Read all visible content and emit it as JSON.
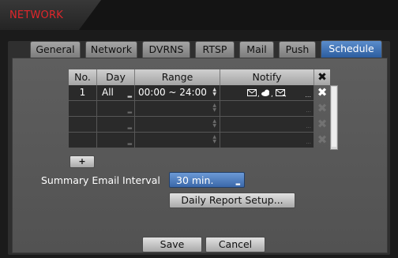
{
  "window": {
    "title": "NETWORK"
  },
  "tabs": [
    "General",
    "Network",
    "DVRNS",
    "RTSP",
    "Mail",
    "Push",
    "Schedule"
  ],
  "active_tab": "Schedule",
  "table": {
    "headers": {
      "no": "No.",
      "day": "Day",
      "range": "Range",
      "notify": "Notify"
    },
    "rows": [
      {
        "no": "1",
        "day": "All",
        "range": "00:00 ~ 24:00",
        "notify_icons": [
          "mail-icon",
          "cloud-icon",
          "mail-attachment-icon"
        ]
      }
    ],
    "empty_rows": 3
  },
  "icons": {
    "delete": "✖",
    "add": "+",
    "notify_more": "..."
  },
  "summary": {
    "label": "Summary Email Interval",
    "value": "30 min."
  },
  "buttons": {
    "daily_report": "Daily Report Setup...",
    "save": "Save",
    "cancel": "Cancel"
  },
  "colors": {
    "title_red": "#e0262b",
    "active_blue": "#2c5d9f",
    "panel_gray": "#5a5a5a"
  }
}
